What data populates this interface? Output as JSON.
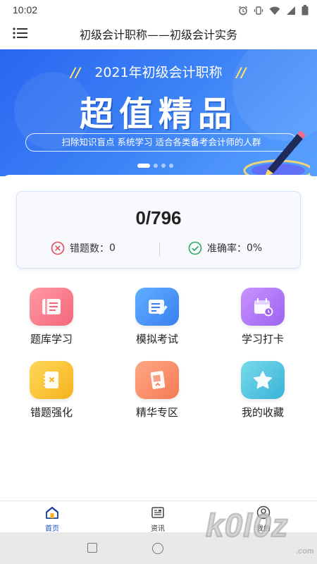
{
  "status_bar": {
    "time": "10:02",
    "icons": [
      "alarm-icon",
      "vibrate-icon",
      "wifi-icon",
      "signal-icon",
      "battery-icon"
    ]
  },
  "header": {
    "title": "初级会计职称——初级会计实务",
    "menu_icon": "menu-icon"
  },
  "banner": {
    "subtitle": "2021年初级会计职称",
    "title": "超值精品",
    "tagline": "扫除知识盲点  系统学习  适合各类备考会计师的人群",
    "page_count": 4,
    "active_page": 1,
    "colors": {
      "bg_start": "#2a66f0",
      "bg_end": "#5aa2ff",
      "accent": "#ffe66a"
    }
  },
  "stats": {
    "progress": "0/796",
    "wrong_label": "错题数：",
    "wrong_value": "0",
    "accuracy_label": "准确率：",
    "accuracy_value": "0%",
    "wrong_color": "#e0505a",
    "accuracy_color": "#2faa5f"
  },
  "features": [
    {
      "label": "题库学习",
      "icon": "question-bank-icon",
      "color_a": "#ff8f98",
      "color_b": "#f4667a"
    },
    {
      "label": "模拟考试",
      "icon": "mock-exam-icon",
      "color_a": "#5aa8ff",
      "color_b": "#3a7ff0"
    },
    {
      "label": "学习打卡",
      "icon": "calendar-checkin-icon",
      "color_a": "#c48bff",
      "color_b": "#9c62f0"
    },
    {
      "label": "错题强化",
      "icon": "wrong-notebook-icon",
      "color_a": "#ffd24a",
      "color_b": "#f5b21c"
    },
    {
      "label": "精华专区",
      "icon": "featured-card-icon",
      "color_a": "#ffa07a",
      "color_b": "#f57a55"
    },
    {
      "label": "我的收藏",
      "icon": "star-icon",
      "color_a": "#6fd6e6",
      "color_b": "#38b3d8"
    }
  ],
  "bottom_nav": [
    {
      "label": "首页",
      "icon": "home-icon",
      "active": true
    },
    {
      "label": "资讯",
      "icon": "news-icon",
      "active": false
    },
    {
      "label": "我的",
      "icon": "profile-icon",
      "active": false
    }
  ],
  "watermark": {
    "text": "k0l0z",
    "suffix": ".com"
  }
}
